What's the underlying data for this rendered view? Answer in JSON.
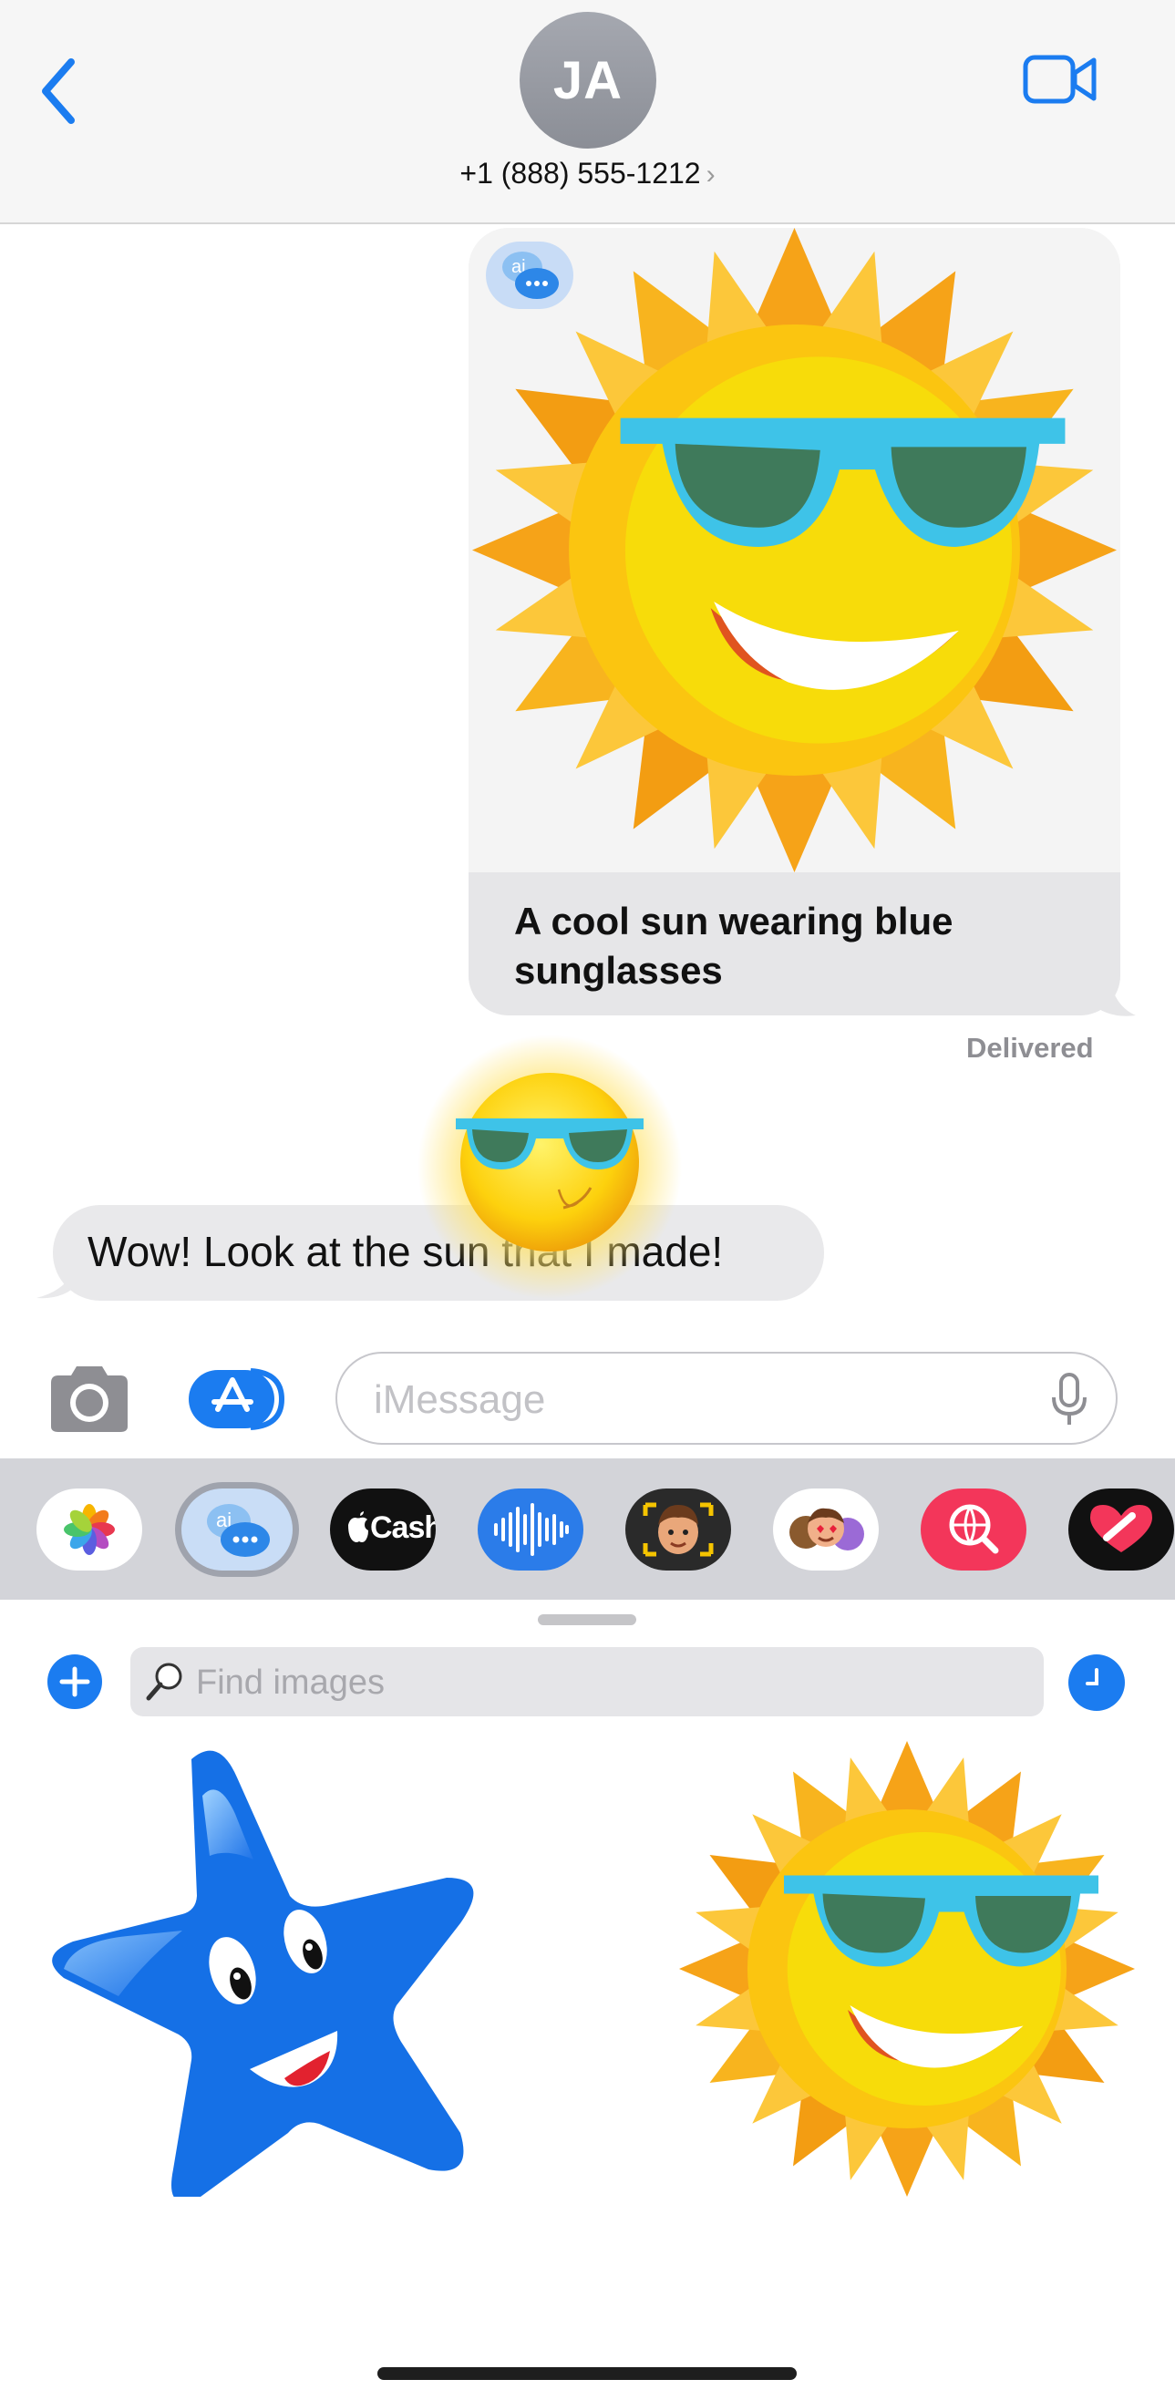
{
  "header": {
    "avatar_initials": "JA",
    "contact": "+1 (888) 555-1212",
    "contact_chevron": "›",
    "back_icon": "chevron-left-icon",
    "video_icon": "video-camera-icon",
    "accent": "#1b7cf0"
  },
  "sent_message": {
    "caption": "A cool sun wearing blue sunglasses",
    "status": "Delivered",
    "badge": "ai"
  },
  "received_message": {
    "text": "Wow! Look at the sun that I made!"
  },
  "compose": {
    "placeholder": "iMessage",
    "camera_icon": "camera-icon",
    "apps_icon": "app-store-icon",
    "mic_icon": "microphone-icon"
  },
  "app_drawer": {
    "apps": [
      {
        "name": "Photos",
        "icon": "photos-icon"
      },
      {
        "name": "AI Images",
        "icon": "ai-chat-icon",
        "selected": true
      },
      {
        "name": "Cash",
        "label": "Cash",
        "icon": "apple-cash-icon"
      },
      {
        "name": "Audio",
        "icon": "audio-waveform-icon"
      },
      {
        "name": "Memoji",
        "icon": "memoji-icon"
      },
      {
        "name": "Memoji Stickers",
        "icon": "memoji-stickers-icon"
      },
      {
        "name": "Images Search",
        "icon": "globe-search-icon"
      },
      {
        "name": "Digital Touch",
        "icon": "heart-icon"
      }
    ]
  },
  "panel": {
    "search_placeholder": "Find images",
    "add_icon": "plus-icon",
    "history_icon": "clock-icon",
    "results": [
      {
        "name": "star-character",
        "icon": "blue-star-sticker"
      },
      {
        "name": "sun-character",
        "icon": "sun-sunglasses-sticker"
      }
    ]
  }
}
